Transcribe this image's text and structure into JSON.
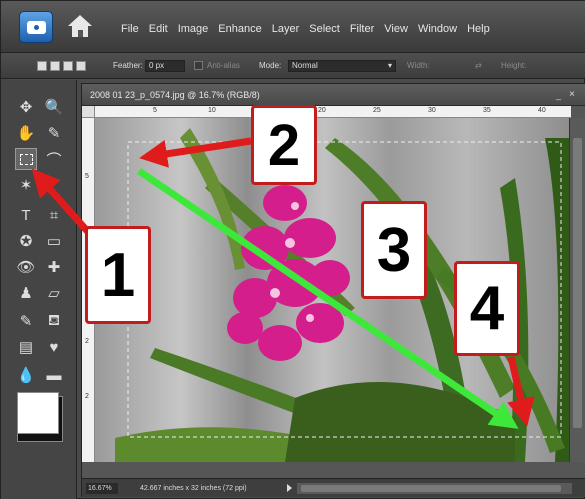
{
  "menubar": {
    "items": [
      "File",
      "Edit",
      "Image",
      "Enhance",
      "Layer",
      "Select",
      "Filter",
      "View",
      "Window",
      "Help"
    ]
  },
  "options": {
    "feather_label": "Feather:",
    "feather_value": "0 px",
    "antialias_label": "Anti-alias",
    "mode_label": "Mode:",
    "mode_value": "Normal",
    "width_label": "Width:",
    "height_label": "Height:"
  },
  "document": {
    "title": "2008 01 23_p_0574.jpg @ 16.7% (RGB/8)",
    "minimize": "_",
    "close": "×",
    "ruler_h": [
      "5",
      "10",
      "15",
      "20",
      "25",
      "30",
      "35",
      "40"
    ],
    "ruler_v": [
      "5",
      "1",
      "1",
      "2",
      "2"
    ],
    "zoom": "16.67%",
    "doc_info": "42.667 inches x 32 inches (72 ppi)"
  },
  "annotations": [
    "1",
    "2",
    "3",
    "4"
  ],
  "colors": {
    "arrow_red": "#e01b1b",
    "arrow_green": "#3ee83a",
    "annotation_border": "#c21d1d",
    "flower": "#d41e8c"
  }
}
